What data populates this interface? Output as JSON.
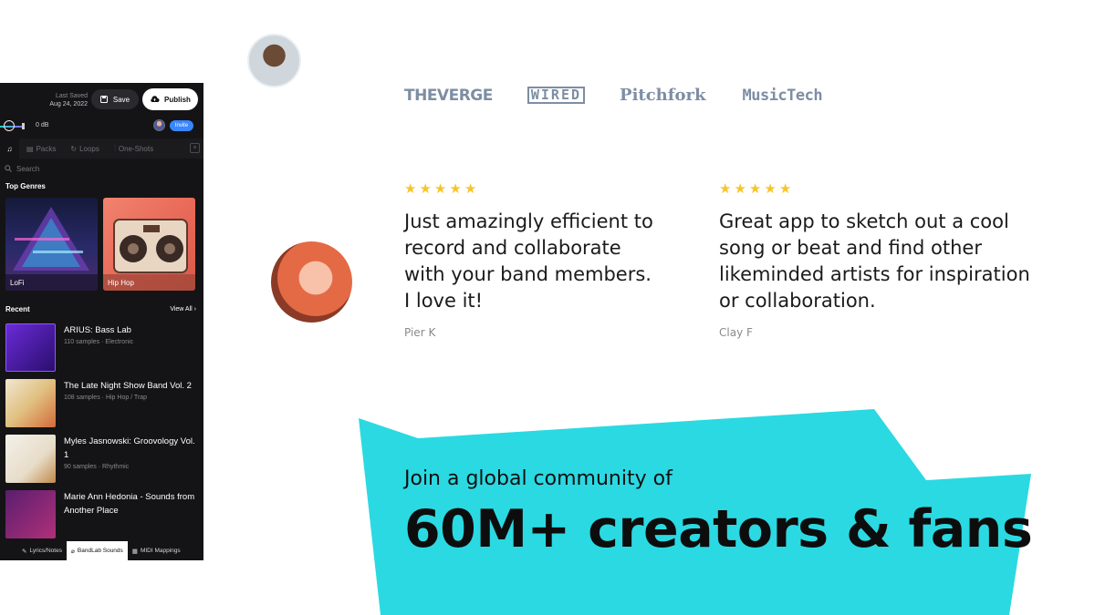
{
  "app": {
    "last_saved_label": "Last Saved",
    "last_saved_date": "Aug 24, 2022",
    "save_label": "Save",
    "publish_label": "Publish",
    "volume": "0 dB",
    "invite_label": "Invite",
    "tabs": [
      "Packs",
      "Loops",
      "One-Shots"
    ],
    "search_placeholder": "Search",
    "top_genres_label": "Top Genres",
    "genres": [
      {
        "label": "LoFi",
        "icon": "triangle-art"
      },
      {
        "label": "Hip Hop",
        "icon": "boombox-art"
      }
    ],
    "recent_label": "Recent",
    "view_all_label": "View All",
    "recent": [
      {
        "title": "ARIUS: Bass Lab",
        "samples": "110 samples",
        "genre": "Electronic"
      },
      {
        "title": "The Late Night Show Band Vol. 2",
        "samples": "108 samples",
        "genre": "Hip Hop / Trap"
      },
      {
        "title": "Myles Jasnowski: Groovology Vol. 1",
        "samples": "90 samples",
        "genre": "Rhythmic"
      },
      {
        "title": "Marie Ann Hedonia - Sounds from Another Place",
        "samples": "",
        "genre": ""
      }
    ],
    "bottom_tabs": [
      "Lyrics/Notes",
      "BandLab Sounds",
      "MIDI Mappings"
    ]
  },
  "press": [
    "THEVERGE",
    "WIRED",
    "Pitchfork",
    "MusicTech"
  ],
  "reviews": [
    {
      "stars": 5,
      "quote": "Just amazingly efficient to record and collaborate with your band members. I love it!",
      "author": "Pier K"
    },
    {
      "stars": 5,
      "quote": "Great app to sketch out a cool song or beat and find other likeminded artists for inspiration or collaboration.",
      "author": "Clay F"
    }
  ],
  "cta": {
    "subtitle": "Join a global community of",
    "headline": "60M+ creators & fans",
    "color": "#2bd9e2"
  },
  "colors": {
    "star": "#f7c52b",
    "press": "#7d8ea3",
    "invite": "#3a86ff"
  }
}
